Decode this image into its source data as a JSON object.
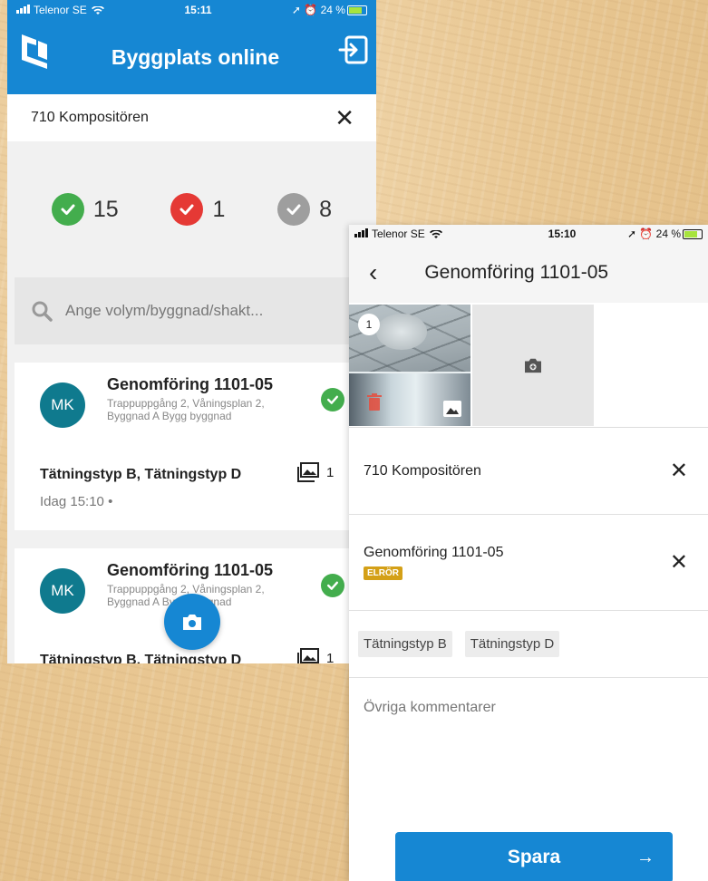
{
  "left_phone": {
    "status": {
      "carrier": "Telenor SE",
      "time": "15:11",
      "battery": "24 %"
    },
    "app_title": "Byggplats online",
    "project_name": "710 Kompositören",
    "stats": [
      {
        "count": "15",
        "color": "#43ad4d"
      },
      {
        "count": "1",
        "color": "#e53935"
      },
      {
        "count": "8",
        "color": "#9e9e9e"
      }
    ],
    "search": {
      "placeholder": "Ange volym/byggnad/shakt..."
    },
    "cards": [
      {
        "avatar": "MK",
        "title": "Genomföring 1101-05",
        "subtitle": "Trappuppgång 2, Våningsplan 2, Byggnad A Bygg byggnad",
        "tags": "Tätningstyp B, Tätningstyp D",
        "image_count": "1",
        "date": "Idag 15:10 •"
      },
      {
        "avatar": "MK",
        "title": "Genomföring 1101-05",
        "subtitle": "Trappuppgång 2, Våningsplan 2, Byggnad A Bygg byggnad",
        "tags": "Tätningstyp B, Tätningstyp D",
        "image_count": "1"
      }
    ]
  },
  "right_phone": {
    "status": {
      "carrier": "Telenor SE",
      "time": "15:10",
      "battery": "24 %"
    },
    "title": "Genomföring 1101-05",
    "photo_badge": "1",
    "project_name": "710 Kompositören",
    "penetration": {
      "name": "Genomföring 1101-05",
      "badge": "ELRÖR"
    },
    "chips": [
      "Tätningstyp B",
      "Tätningstyp D"
    ],
    "comments_placeholder": "Övriga kommentarer",
    "save_label": "Spara",
    "save_arrow": "→"
  },
  "colors": {
    "primary": "#1687d3",
    "success": "#43ad4d",
    "error": "#e53935",
    "neutral": "#9e9e9e",
    "badge": "#d4a017"
  }
}
